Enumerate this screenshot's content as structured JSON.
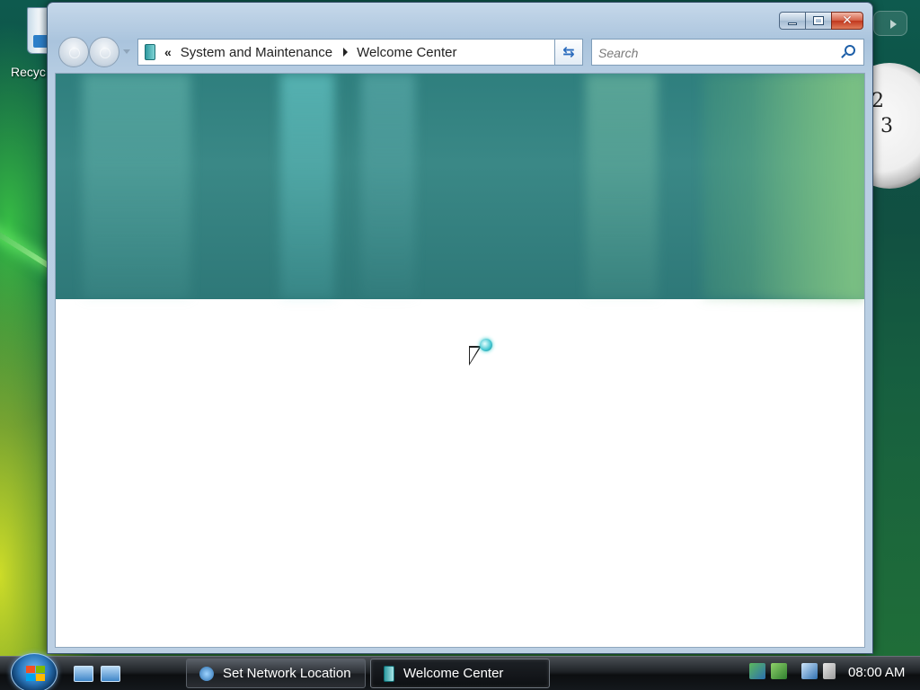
{
  "desktop": {
    "recycle_bin_label": "Recyc",
    "clock_numbers": [
      "2",
      "3"
    ]
  },
  "window": {
    "title": "Welcome Center",
    "caption_buttons": {
      "minimize": "minimize",
      "maximize": "maximize",
      "close": "✕"
    },
    "address_bar": {
      "overflow": "«",
      "breadcrumbs": [
        "System and Maintenance",
        "Welcome Center"
      ]
    },
    "search": {
      "placeholder": "Search"
    },
    "refresh_glyph": "⇆"
  },
  "taskbar": {
    "buttons": [
      {
        "label": "Set Network Location",
        "icon": "network-icon",
        "active": false
      },
      {
        "label": "Welcome Center",
        "icon": "welcome-center-icon",
        "active": true
      }
    ],
    "clock": "08:00 AM"
  },
  "colors": {
    "banner": "#2f7f7e",
    "window_frame": "#bcd0e4",
    "taskbar": "#1e2226"
  }
}
